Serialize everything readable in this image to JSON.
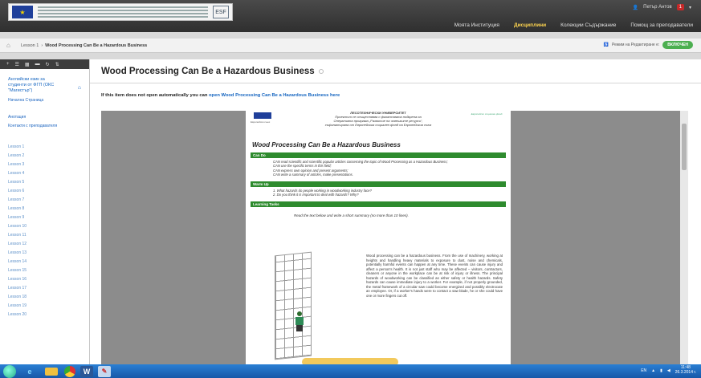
{
  "header": {
    "user_name": "Петър Антов",
    "notifications": "1",
    "nav": [
      "Моята Институция",
      "Дисциплини",
      "Колекции Съдържание",
      "Помощ за преподаватели"
    ],
    "active_nav_index": 1
  },
  "breadcrumb": {
    "lesson": "Lesson 1",
    "separator": "›",
    "page": "Wood Processing Can Be a Hazardous Business",
    "edit_mode_label": "Режим на Редактиране е:",
    "edit_mode_state": "ВКЛЮЧЕН"
  },
  "sidebar": {
    "course_title": "Английски език за студенти от ФГП (ОКС \"Магистър\")",
    "links": [
      "Начална Страница",
      "Анотация",
      "Контакти с преподавателя"
    ],
    "lessons": [
      "Lesson 1",
      "Lesson 2",
      "Lesson 3",
      "Lesson 4",
      "Lesson 5",
      "Lesson 6",
      "Lesson 7",
      "Lesson 8",
      "Lesson 9",
      "Lesson 10",
      "Lesson 11",
      "Lesson 12",
      "Lesson 13",
      "Lesson 14",
      "Lesson 15",
      "Lesson 16",
      "Lesson 17",
      "Lesson 18",
      "Lesson 19",
      "Lesson 20"
    ]
  },
  "content": {
    "title": "Wood Processing Can Be a Hazardous Business",
    "auto_open_prefix": "If this item does not open automatically you can",
    "auto_open_link": "open Wood Processing Can Be a Hazardous Business here"
  },
  "document": {
    "eu_caption": "Европейски съюз",
    "university": "ЛЕСОТЕХНИЧЕСКИ УНИВЕРСИТЕТ",
    "project_line1": "Проектът се осъществява с финансовата подкрепа на",
    "project_line2": "Оперативна програма „Развитие на човешките ресурси“,",
    "project_line3": "съфинансирана от Европейския социален фонд на Европейския съюз",
    "esf_caption": "Европейски социален фонд",
    "title": "Wood Processing Can Be a Hazardous Business",
    "can_do_label": "Can Do",
    "can_do_items": [
      "CAN read scientific and scientific popular articles concerning the topic of Wood Processing as a Hazardous Business;",
      "CAN use the specific terms in this field;",
      "CAN express own opinion and present arguments;",
      "CAN write a summary of articles, make presentations."
    ],
    "warm_up_label": "Warm Up",
    "warm_up_items": [
      "1.   What hazards do people working in woodworking industry face?",
      "2.   Do you think it is important to deal with hazards? Why?"
    ],
    "learning_tasks_label": "Learning Tasks",
    "task_intro": "Read the text below and write a short summary (no more than 10 lines).",
    "body": "Wood processing can be a hazardous business. From the use of machinery, working at heights and handling heavy materials to exposure to dust, noise and chemicals, potentially harmful events can happen at any time. These events can cause injury and affect a person's health. It is not just staff who may be affected – visitors, contractors, cleaners or anyone in the workplace can be at risk of injury or illness. The principal hazards of woodworking can be classified as either safety or health hazards. Safety hazards can cause immediate injury to a worker. For example, if not properly grounded, the metal framework of a circular saw could become energized and possibly electrocute an employee. Or, if a worker's hands were to contact a saw blade, he or she could have one or more fingers cut off."
  },
  "taskbar": {
    "lang": "EN",
    "time": "11:48",
    "date": "26.3.2014 г."
  },
  "colors": {
    "accent_green": "#2e8b2e",
    "link_blue": "#1565c0",
    "active_nav": "#ffd54f"
  }
}
